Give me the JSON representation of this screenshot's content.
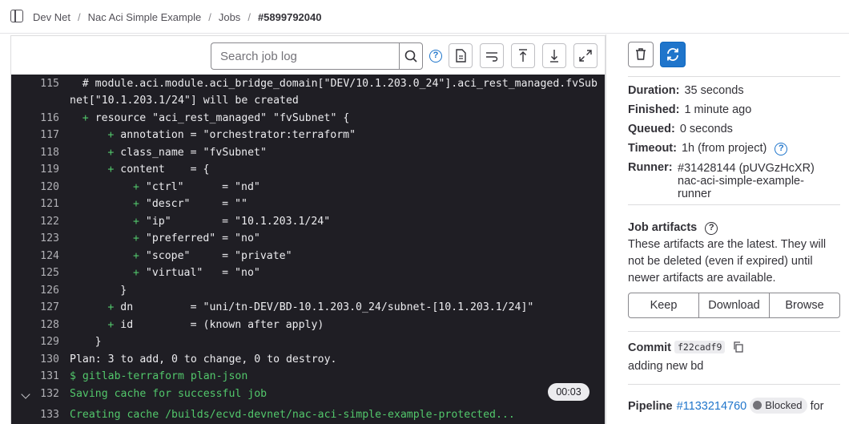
{
  "breadcrumb": [
    "Dev Net",
    "Nac Aci Simple Example",
    "Jobs",
    "#5899792040"
  ],
  "toolbar": {
    "search_placeholder": "Search job log"
  },
  "log": {
    "lines": [
      {
        "num": "115",
        "text": "# module.aci.module.aci_bridge_domain[\"DEV/10.1.203.0_24\"].aci_rest_managed.fvSub",
        "indent": 1
      },
      {
        "num": "",
        "text": "net[\"10.1.203.1/24\"] will be created",
        "indent": 0
      },
      {
        "num": "116",
        "plus": "+",
        "text": "resource \"aci_rest_managed\" \"fvSubnet\" {",
        "indent": 1
      },
      {
        "num": "117",
        "plus": "+",
        "text": "annotation = \"orchestrator:terraform\"",
        "indent": 3
      },
      {
        "num": "118",
        "plus": "+",
        "text": "class_name = \"fvSubnet\"",
        "indent": 3
      },
      {
        "num": "119",
        "plus": "+",
        "text": "content    = {",
        "indent": 3
      },
      {
        "num": "120",
        "plus": "+",
        "text": "\"ctrl\"      = \"nd\"",
        "indent": 5
      },
      {
        "num": "121",
        "plus": "+",
        "text": "\"descr\"     = \"\"",
        "indent": 5
      },
      {
        "num": "122",
        "plus": "+",
        "text": "\"ip\"        = \"10.1.203.1/24\"",
        "indent": 5
      },
      {
        "num": "123",
        "plus": "+",
        "text": "\"preferred\" = \"no\"",
        "indent": 5
      },
      {
        "num": "124",
        "plus": "+",
        "text": "\"scope\"     = \"private\"",
        "indent": 5
      },
      {
        "num": "125",
        "plus": "+",
        "text": "\"virtual\"   = \"no\"",
        "indent": 5
      },
      {
        "num": "126",
        "text": "}",
        "indent": 4
      },
      {
        "num": "127",
        "plus": "+",
        "text": "dn         = \"uni/tn-DEV/BD-10.1.203.0_24/subnet-[10.1.203.1/24]\"",
        "indent": 3
      },
      {
        "num": "128",
        "plus": "+",
        "text": "id         = (known after apply)",
        "indent": 3
      },
      {
        "num": "129",
        "text": "}",
        "indent": 2
      },
      {
        "num": "130",
        "text": "Plan: 3 to add, 0 to change, 0 to destroy.",
        "indent": 0
      },
      {
        "num": "131",
        "text": "$ gitlab-terraform plan-json",
        "indent": 0,
        "green": true
      },
      {
        "num": "132",
        "text": "Saving cache for successful job",
        "indent": 0,
        "green": true,
        "section": true
      },
      {
        "num": "133",
        "text": "Creating cache /builds/ecvd-devnet/nac-aci-simple-example-protected...",
        "indent": 0,
        "green": true
      }
    ],
    "section_duration": "00:03"
  },
  "sidebar": {
    "duration_label": "Duration:",
    "duration": "35 seconds",
    "finished_label": "Finished:",
    "finished": "1 minute ago",
    "queued_label": "Queued:",
    "queued": "0 seconds",
    "timeout_label": "Timeout:",
    "timeout": "1h (from project)",
    "runner_label": "Runner:",
    "runner": "#31428144 (pUVGzHcXR) nac-aci-simple-example-runner",
    "artifacts_title": "Job artifacts",
    "artifacts_text": "These artifacts are the latest. They will not be deleted (even if expired) until newer artifacts are available.",
    "keep": "Keep",
    "download": "Download",
    "browse": "Browse",
    "commit_label": "Commit",
    "commit_sha": "f22cadf9",
    "commit_message": "adding new bd",
    "pipeline_label": "Pipeline",
    "pipeline_id": "#1133214760",
    "pipeline_status": "Blocked",
    "pipeline_suffix": "for"
  },
  "colors": {
    "accent": "#1f75cb",
    "log_bg": "#1f1e24",
    "log_green": "#52c76b"
  },
  "icons": [
    "sidebar-toggle-icon",
    "search-icon",
    "help-icon",
    "raw-log-icon",
    "wrap-lines-icon",
    "scroll-top-icon",
    "scroll-bottom-icon",
    "fullscreen-icon",
    "trash-icon",
    "retry-icon",
    "copy-icon",
    "chevron-down-icon"
  ]
}
